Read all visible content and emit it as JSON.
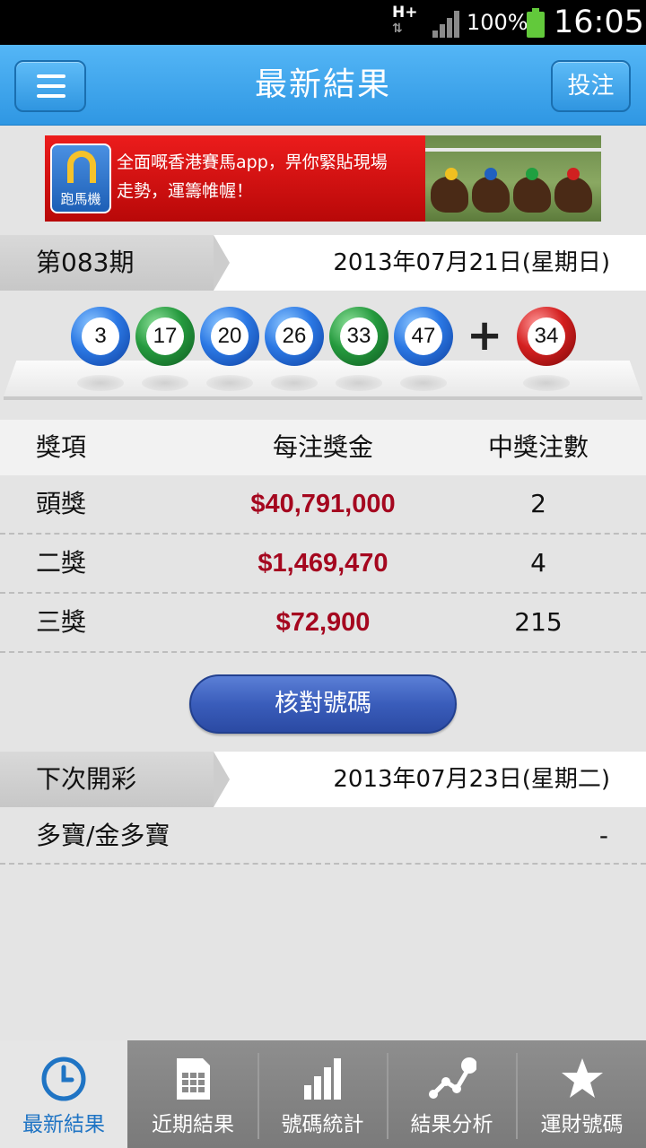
{
  "status_bar": {
    "network": "H+",
    "battery": "100%",
    "time": "16:05"
  },
  "header": {
    "title": "最新結果",
    "bet_label": "投注"
  },
  "banner": {
    "logo_text": "跑馬機",
    "line1": "全面嘅香港賽馬app，畀你緊貼現場",
    "line2": "走勢，運籌帷幄！"
  },
  "draw": {
    "number_label": "第083期",
    "date": "2013年07月21日(星期日)"
  },
  "balls": [
    {
      "number": "3",
      "color": "blue"
    },
    {
      "number": "17",
      "color": "green"
    },
    {
      "number": "20",
      "color": "blue"
    },
    {
      "number": "26",
      "color": "blue"
    },
    {
      "number": "33",
      "color": "green"
    },
    {
      "number": "47",
      "color": "blue"
    }
  ],
  "extra_ball": {
    "number": "34",
    "color": "red"
  },
  "prize_table": {
    "headers": [
      "獎項",
      "每注獎金",
      "中獎注數"
    ],
    "rows": [
      {
        "prize": "頭獎",
        "amount": "$40,791,000",
        "winners": "2"
      },
      {
        "prize": "二獎",
        "amount": "$1,469,470",
        "winners": "4"
      },
      {
        "prize": "三獎",
        "amount": "$72,900",
        "winners": "215"
      }
    ]
  },
  "check_button": "核對號碼",
  "next_draw": {
    "label": "下次開彩",
    "date": "2013年07月23日(星期二)"
  },
  "multi": {
    "label": "多寶/金多寶",
    "value": "-"
  },
  "tabs": [
    {
      "label": "最新結果",
      "icon": "clock-icon",
      "active": true
    },
    {
      "label": "近期結果",
      "icon": "calendar-icon",
      "active": false
    },
    {
      "label": "號碼統計",
      "icon": "bar-chart-icon",
      "active": false
    },
    {
      "label": "結果分析",
      "icon": "line-graph-icon",
      "active": false
    },
    {
      "label": "運財號碼",
      "icon": "star-icon",
      "active": false
    }
  ],
  "colors": {
    "accent": "#2f97e3",
    "money": "#a5071f",
    "tab_active": "#1f74c4",
    "button": "#3a5dbb"
  }
}
